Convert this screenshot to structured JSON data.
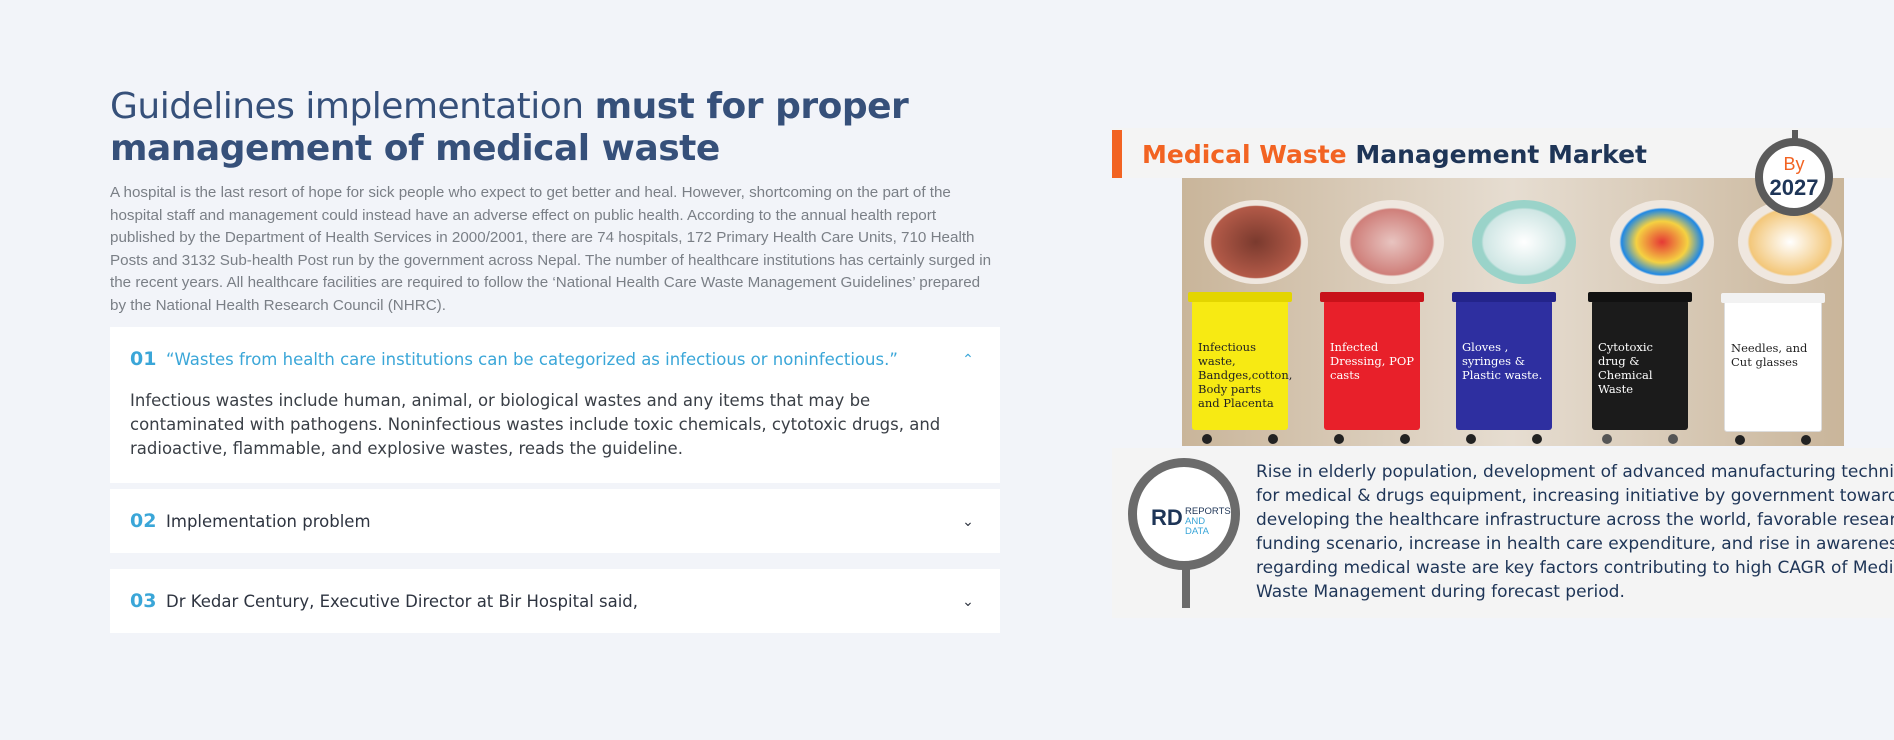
{
  "heading": {
    "light": "Guidelines implementation",
    "bold": "must for proper management of medical waste"
  },
  "intro": "A hospital is the last resort of hope for sick people who expect to get better and heal. However, shortcoming on the part of the hospital staff and management could instead have an adverse effect on public health. According to the annual health report published by the Department of Health Services in 2000/2001, there are 74 hospitals, 172 Primary Health Care Units, 710 Health Posts and 3132 Sub-health Post run by the government across Nepal. The number of healthcare institutions has certainly surged in the recent years. All healthcare facilities are required to follow the ‘National Health Care Waste Management Guidelines’ prepared by the National Health Research Council (NHRC).",
  "accordion": [
    {
      "num": "01",
      "title": "“Wastes from health care institutions can be categorized as infectious or noninfectious.”",
      "expanded": true,
      "body": "Infectious wastes include human, animal, or biological wastes and any items that may be contaminated with pathogens. Noninfectious wastes include toxic chemicals, cytotoxic drugs, and radioactive, flammable, and explosive wastes, reads the guideline."
    },
    {
      "num": "02",
      "title": "Implementation problem",
      "expanded": false
    },
    {
      "num": "03",
      "title": "Dr Kedar Century, Executive Director at Bir Hospital said,",
      "expanded": false
    }
  ],
  "infographic": {
    "title_orange": "Medical Waste",
    "title_dark": "Management Market",
    "badge_by": "By",
    "badge_year": "2027",
    "bins": [
      "Infectious waste, Bandges,cotton, Body parts and Placenta",
      "Infected Dressing, POP casts",
      "Gloves , syringes & Plastic waste.",
      "Cytotoxic drug & Chemical Waste",
      "Needles, and Cut glasses"
    ],
    "logo_rd": "RD",
    "logo_line1": "REPORTS",
    "logo_line2": "AND DATA",
    "text_lines": [
      "Rise in elderly population, development of advanced manufacturing techniques",
      "for medical & drugs equipment, increasing initiative by government towards",
      "developing the healthcare infrastructure across the world, favorable research",
      "funding scenario, increase in health care expenditure, and rise in awareness",
      "regarding medical waste are key factors contributing to high CAGR of Medical",
      "Waste Management during forecast period."
    ]
  },
  "colors": {
    "accent": "#3aa6d8",
    "heading": "#36507a",
    "orange": "#f26322"
  }
}
